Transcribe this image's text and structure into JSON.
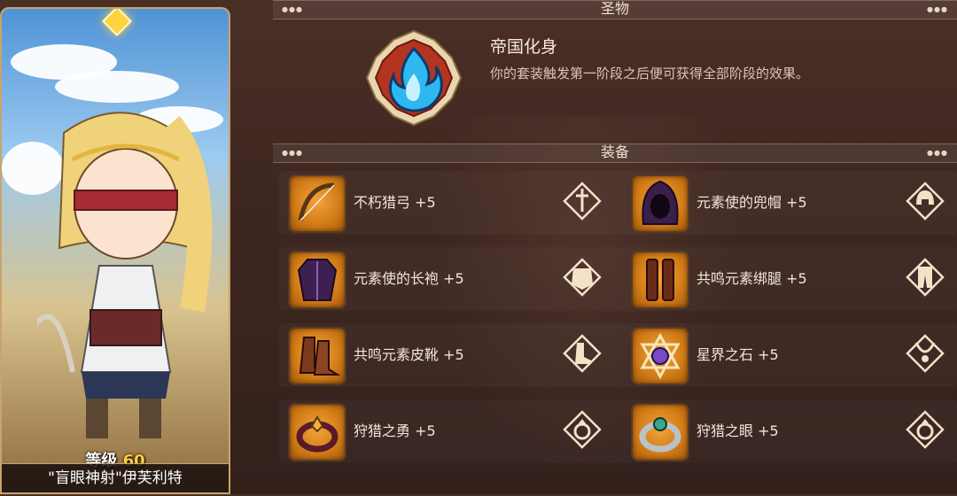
{
  "hero": {
    "level_label": "等级",
    "level_value": "60",
    "name": "\"盲眼神射\"伊芙利特"
  },
  "relic_section": {
    "title": "圣物"
  },
  "relic": {
    "icon": "blue-flame-icon",
    "name": "帝国化身",
    "description": "你的套装触发第一阶段之后便可获得全部阶段的效果。"
  },
  "equipment_section": {
    "title": "装备"
  },
  "equipment": [
    {
      "label": "不朽猎弓 +5",
      "icon": "bow-icon",
      "slot_icon": "weapon-slot-icon"
    },
    {
      "label": "元素使的兜帽 +5",
      "icon": "hood-icon",
      "slot_icon": "helmet-slot-icon"
    },
    {
      "label": "元素使的长袍 +5",
      "icon": "robe-icon",
      "slot_icon": "armor-slot-icon"
    },
    {
      "label": "共鸣元素绑腿 +5",
      "icon": "leggings-icon",
      "slot_icon": "pants-slot-icon"
    },
    {
      "label": "共鸣元素皮靴 +5",
      "icon": "boots-icon",
      "slot_icon": "boots-slot-icon"
    },
    {
      "label": "星界之石 +5",
      "icon": "star-stone-icon",
      "slot_icon": "necklace-slot-icon"
    },
    {
      "label": "狩猎之勇 +5",
      "icon": "ring-icon",
      "slot_icon": "ring-slot-icon"
    },
    {
      "label": "狩猎之眼 +5",
      "icon": "ring-icon",
      "slot_icon": "ring-slot-icon"
    }
  ],
  "colors": {
    "icon_bg": "#e08c25",
    "frame_gold": "#c9a46a",
    "relic_red": "#b3351f",
    "flame_blue": "#2fb8f0"
  }
}
